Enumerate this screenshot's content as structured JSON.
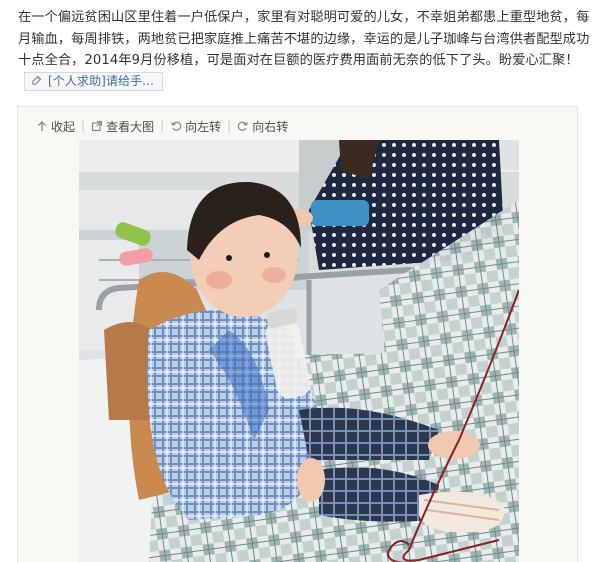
{
  "post": {
    "text": "在一个偏远贫困山区里住着一户低保户，家里有对聪明可爱的儿女，不幸姐弟都患上重型地贫，每月输血，每周排铁，两地贫已把家庭推上痛苦不堪的边缘，幸运的是儿子珈峰与台湾供者配型成功十点全合，2014年9月份移植，可是面对在巨额的医疗费用面前无奈的低下了头。盼爱心汇聚！",
    "tag_label": "[个人求助]请给手..."
  },
  "toolbar": {
    "collapse_label": "收起",
    "view_large_label": "查看大图",
    "rotate_left_label": "向左转",
    "rotate_right_label": "向右转"
  },
  "icons": {
    "tag": "link-icon",
    "collapse": "arrow-up-icon",
    "view_large": "external-view-icon",
    "rotate_left": "rotate-left-icon",
    "rotate_right": "rotate-right-icon"
  },
  "colors": {
    "link": "#3d6fa6",
    "text": "#333333",
    "panel_bg": "#f8f8f4"
  }
}
